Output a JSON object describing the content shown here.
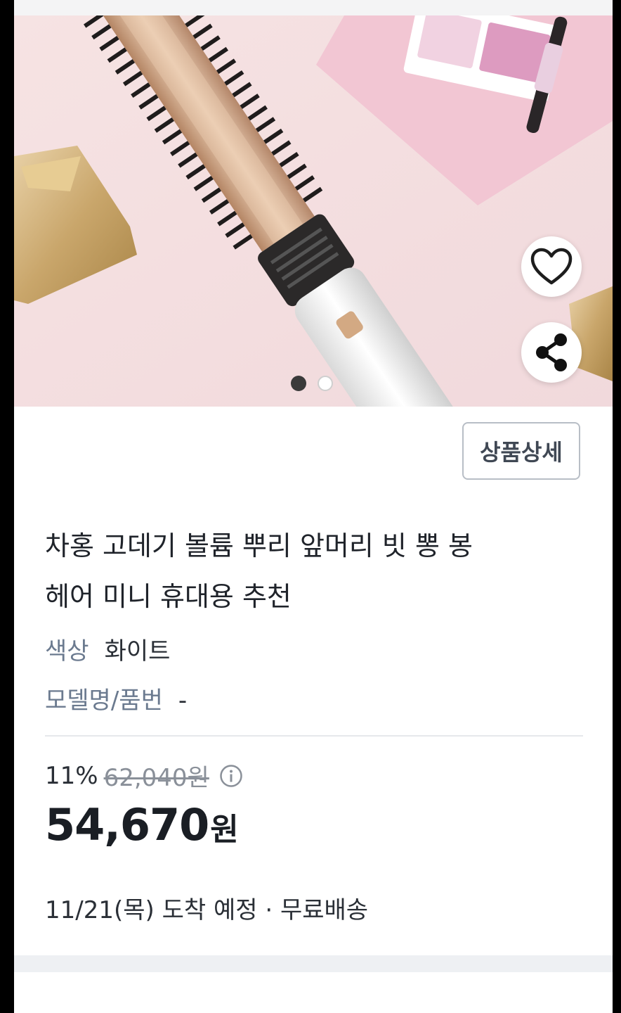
{
  "hero": {
    "wishlist_icon": "heart-outline-icon",
    "share_icon": "share-icon",
    "carousel": {
      "count": 2,
      "active_index": 0
    }
  },
  "product": {
    "detail_button_label": "상품상세",
    "title_line1": "차홍 고데기 볼륨 뿌리 앞머리 빗 뽕 봉",
    "title_line2": "헤어 미니 휴대용 추천",
    "color_label": "색상",
    "color_value": "화이트",
    "model_label": "모델명/품번",
    "model_value": "-"
  },
  "pricing": {
    "discount_rate": "11%",
    "original_price": "62,040원",
    "info_icon": "info-circle-icon",
    "sale_price": "54,670",
    "currency": "원"
  },
  "delivery": {
    "text": "11/21(목) 도착 예정 · 무료배송"
  },
  "colors": {
    "hero_background": "#f3dfe0",
    "label_gray": "#6b7a8f",
    "text_dark": "#1f232a"
  }
}
